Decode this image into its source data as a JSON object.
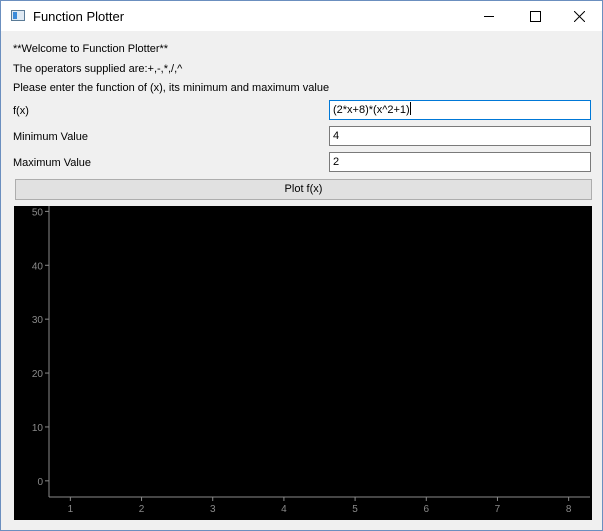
{
  "window": {
    "title": "Function Plotter",
    "icon": "app-window-icon"
  },
  "intro": {
    "welcome": "**Welcome to Function Plotter**",
    "operators": "The operators supplied are:+,-,*,/,^",
    "instructions": "Please enter the function of (x), its minimum and maximum value"
  },
  "form": {
    "fx_label": "f(x)",
    "fx_value": "(2*x+8)*(x^2+1)",
    "min_label": "Minimum Value",
    "min_value": "4",
    "max_label": "Maximum Value",
    "max_value": "2"
  },
  "plot_button_label": "Plot f(x)",
  "chart_data": {
    "type": "line",
    "title": "",
    "xlabel": "",
    "ylabel": "",
    "series": [],
    "xlim": [
      0.7,
      8.3
    ],
    "ylim": [
      -3,
      51
    ],
    "xticks": [
      "1",
      "2",
      "3",
      "4",
      "5",
      "6",
      "7",
      "8"
    ],
    "yticks": [
      "0",
      "10",
      "20",
      "30",
      "40",
      "50"
    ],
    "grid": false,
    "background": "#000000",
    "axis_color": "#8a8a8a"
  }
}
